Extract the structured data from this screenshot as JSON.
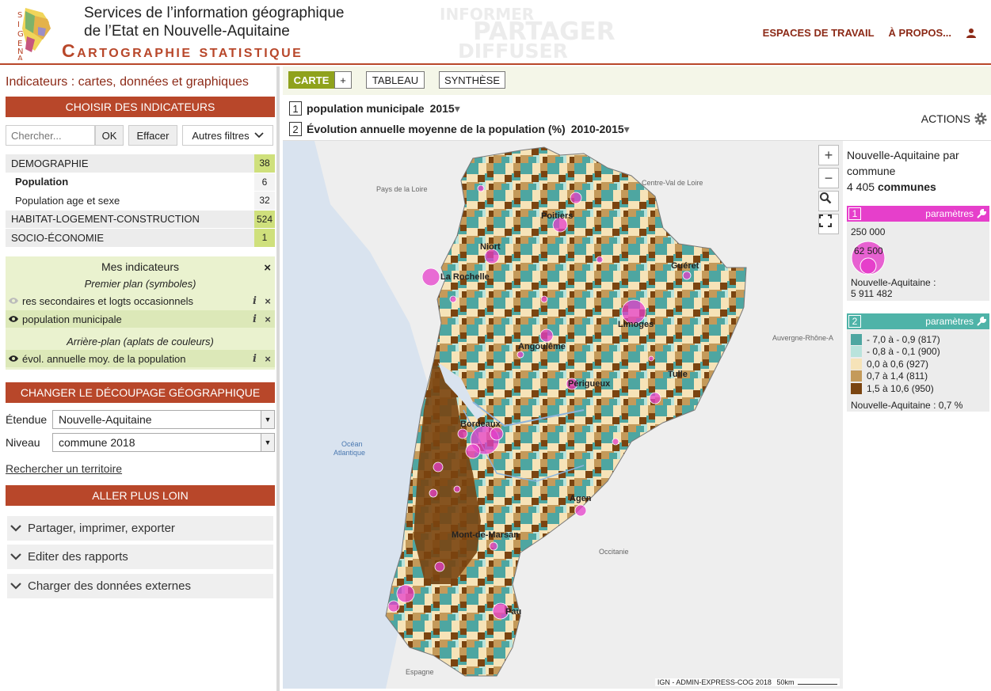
{
  "header": {
    "title_line1": "Services de l’information géographique",
    "title_line2": "de l’Etat en Nouvelle-Aquitaine",
    "title_line3": "Cartographie statistique",
    "logo_text": "SIGENA",
    "watermark1": "INFORMER",
    "watermark2": "PARTAGER",
    "watermark3": "DIFFUSER",
    "nav_workspaces": "ESPACES DE TRAVAIL",
    "nav_about": "À PROPOS...",
    "accent_color": "#b8472a"
  },
  "sidebar": {
    "title": "Indicateurs : cartes, données et graphiques",
    "choose_label": "CHOISIR DES INDICATEURS",
    "search_placeholder": "Chercher...",
    "ok_label": "OK",
    "clear_label": "Effacer",
    "filters_label": "Autres filtres",
    "categories": [
      {
        "label": "DEMOGRAPHIE",
        "count": "38"
      },
      {
        "label": "Population",
        "count": "6"
      },
      {
        "label": "Population age et sexe",
        "count": "32"
      },
      {
        "label": "HABITAT-LOGEMENT-CONSTRUCTION",
        "count": "524"
      },
      {
        "label": "SOCIO-ÉCONOMIE",
        "count": "1"
      }
    ],
    "my_indicators": {
      "title": "Mes indicateurs",
      "foreground": "Premier plan (symboles)",
      "background": "Arrière-plan (aplats de couleurs)",
      "items": [
        {
          "label": "res secondaires et logts occasionnels"
        },
        {
          "label": "population municipale"
        },
        {
          "label": "évol. annuelle moy. de la population"
        }
      ],
      "info_glyph": "i",
      "close_glyph": "×"
    },
    "decoupage_label": "CHANGER LE DÉCOUPAGE GÉOGRAPHIQUE",
    "etendue_label": "Étendue",
    "etendue_value": "Nouvelle-Aquitaine",
    "niveau_label": "Niveau",
    "niveau_value": "commune 2018",
    "search_territory": "Rechercher un territoire",
    "further_label": "ALLER PLUS LOIN",
    "accordions": [
      "Partager, imprimer, exporter",
      "Editer des rapports",
      "Charger des données externes"
    ]
  },
  "toolbar": {
    "carte": "CARTE",
    "plus": "+",
    "tableau": "TABLEAU",
    "synthese": "SYNTHÈSE"
  },
  "indicators": [
    {
      "num": "1",
      "name": "population municipale",
      "year": "2015"
    },
    {
      "num": "2",
      "name": "Évolution annuelle moyenne de la population (%)",
      "year": "2010-2015"
    }
  ],
  "actions_label": "ACTIONS",
  "map": {
    "controls": [
      "+",
      "−"
    ],
    "attribution": "IGN - ADMIN-EXPRESS-COG 2018",
    "scale": "50km",
    "region_labels": [
      "Pays de la Loire",
      "Centre-Val de Loire",
      "Auvergne-Rhône-A",
      "Occitanie",
      "Espagne",
      "Océan",
      "Atlantique"
    ],
    "cities": [
      "Poitiers",
      "Niort",
      "La Rochelle",
      "Guéret",
      "Limoges",
      "Angoulême",
      "Tulle",
      "Périgueux",
      "Bordeaux",
      "Agen",
      "Mont-de-Marsan",
      "Pau"
    ]
  },
  "legend": {
    "title_a": "Nouvelle-Aquitaine par",
    "title_b": "commune",
    "count": "4 405",
    "count_unit": "communes",
    "params_label": "paramètres",
    "l1_num": "1",
    "l1_color": "#e63fcb",
    "l1_big": "250 000",
    "l1_small": "62 500",
    "l1_total_label": "Nouvelle-Aquitaine :",
    "l1_total": "5 911 482",
    "l2_num": "2",
    "l2_color": "#4fb3a8",
    "classes": [
      {
        "label": "- 7,0 à - 0,9 (817)",
        "color": "#4ea6a1"
      },
      {
        "label": "- 0,8 à - 0,1 (900)",
        "color": "#b9e3dc"
      },
      {
        "label": "0,0 à 0,6 (927)",
        "color": "#f6e3b8"
      },
      {
        "label": "0,7 à 1,4 (811)",
        "color": "#c49a5a"
      },
      {
        "label": "1,5 à 10,6 (950)",
        "color": "#7a4410"
      }
    ],
    "l2_total": "Nouvelle-Aquitaine : 0,7 %"
  }
}
